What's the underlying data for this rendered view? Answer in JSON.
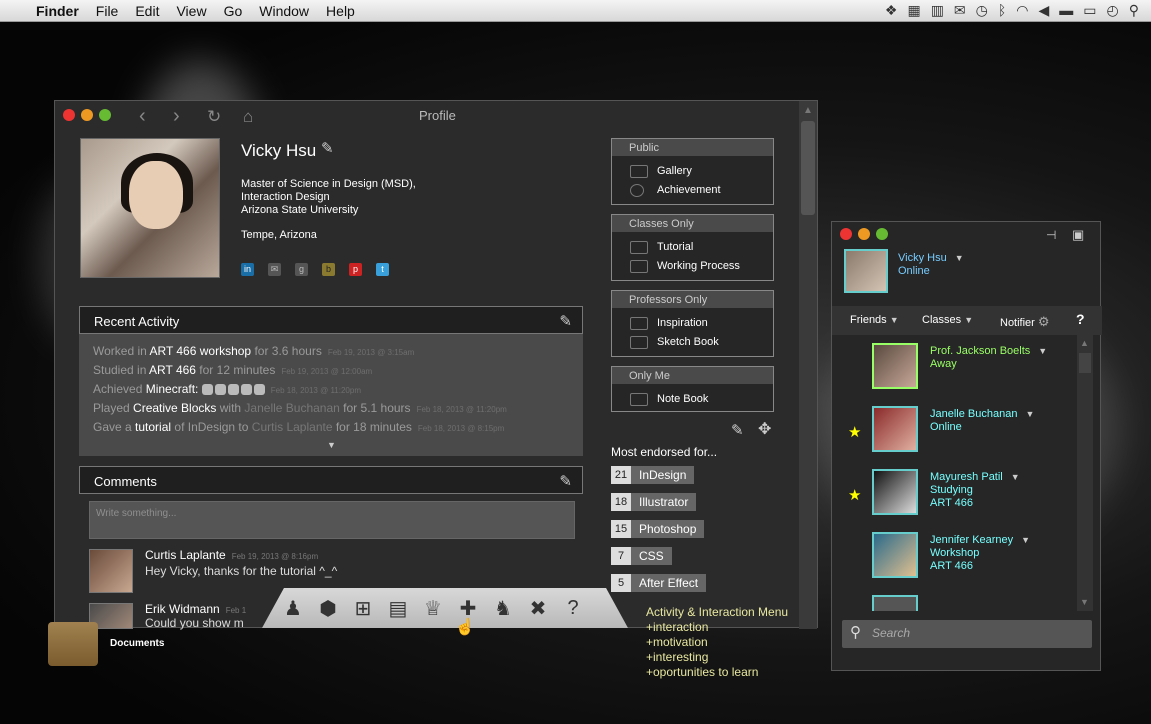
{
  "menubar": {
    "app": "Finder",
    "items": [
      "File",
      "Edit",
      "View",
      "Go",
      "Window",
      "Help"
    ]
  },
  "profile": {
    "window_title": "Profile",
    "name": "Vicky Hsu",
    "degree_line1": "Master of Science in Design (MSD),",
    "degree_line2": "Interaction Design",
    "degree_line3": "Arizona State University",
    "location": "Tempe, Arizona",
    "recent_activity": {
      "title": "Recent Activity",
      "lines": [
        {
          "pre": "Worked in ",
          "hl": "ART 466 workshop",
          "post": " for 3.6 hours",
          "ts": "Feb 19, 2013 @ 3:15am"
        },
        {
          "pre": "Studied in ",
          "hl": "ART 466",
          "post": " for 12 minutes",
          "ts": "Feb 19, 2013 @ 12:00am"
        },
        {
          "pre": "Achieved ",
          "hl": "Minecraft:",
          "post": "",
          "ts": "Feb 18, 2013 @ 11:20pm"
        },
        {
          "pre": "Played ",
          "hl": "Creative Blocks",
          "post": " with ",
          "mut": "Janelle Buchanan",
          "post2": " for 5.1 hours",
          "ts": "Feb 18, 2013 @ 11:20pm"
        },
        {
          "pre": "Gave a ",
          "hl": "tutorial",
          "post": " of InDesign to ",
          "mut": "Curtis Laplante",
          "post2": " for 18 minutes",
          "ts": "Feb 18, 2013 @ 8:15pm"
        }
      ]
    },
    "comments": {
      "title": "Comments",
      "placeholder": "Write something...",
      "items": [
        {
          "name": "Curtis Laplante",
          "ts": "Feb 19, 2013 @ 8:16pm",
          "text": "Hey Vicky, thanks for the tutorial ^_^"
        },
        {
          "name": "Erik Widmann",
          "ts": "Feb 1",
          "text": "Could you show m"
        }
      ]
    },
    "groups": [
      {
        "header": "Public",
        "items": [
          "Gallery",
          "Achievement"
        ]
      },
      {
        "header": "Classes Only",
        "items": [
          "Tutorial",
          "Working Process"
        ]
      },
      {
        "header": "Professors Only",
        "items": [
          "Inspiration",
          "Sketch Book"
        ]
      },
      {
        "header": "Only Me",
        "items": [
          "Note Book"
        ]
      }
    ],
    "endorsed_title": "Most endorsed for...",
    "endorsed": [
      {
        "count": "21",
        "skill": "InDesign"
      },
      {
        "count": "18",
        "skill": "Illustrator"
      },
      {
        "count": "15",
        "skill": "Photoshop"
      },
      {
        "count": "7",
        "skill": "CSS"
      },
      {
        "count": "5",
        "skill": "After Effect"
      }
    ]
  },
  "activity_menu": {
    "icons": [
      "profile-icon",
      "box-icon",
      "cart-icon",
      "clipboard-icon",
      "trophy-icon",
      "gamepad-icon",
      "people-icon",
      "tools-icon",
      "help-icon"
    ],
    "annotation": [
      "Activity & Interaction Menu",
      "+interaction",
      "+motivation",
      "+interesting",
      "+oportunities to learn"
    ]
  },
  "desktop": {
    "documents_label": "Documents"
  },
  "friends": {
    "me_name": "Vicky Hsu",
    "me_status": "Online",
    "tabs": [
      "Friends",
      "Classes",
      "Notifier",
      "?"
    ],
    "list": [
      {
        "name": "Prof. Jackson Boelts",
        "status": "Away",
        "extra": "",
        "starred": false,
        "color": "#9f6"
      },
      {
        "name": "Janelle Buchanan",
        "status": "Online",
        "extra": "",
        "starred": true,
        "color": "#7ff"
      },
      {
        "name": "Mayuresh Patil",
        "status": "Studying",
        "extra": "ART 466",
        "starred": true,
        "color": "#7ff"
      },
      {
        "name": "Jennifer Kearney",
        "status": "Workshop",
        "extra": "ART 466",
        "starred": false,
        "color": "#7ff"
      }
    ],
    "search_placeholder": "Search"
  }
}
